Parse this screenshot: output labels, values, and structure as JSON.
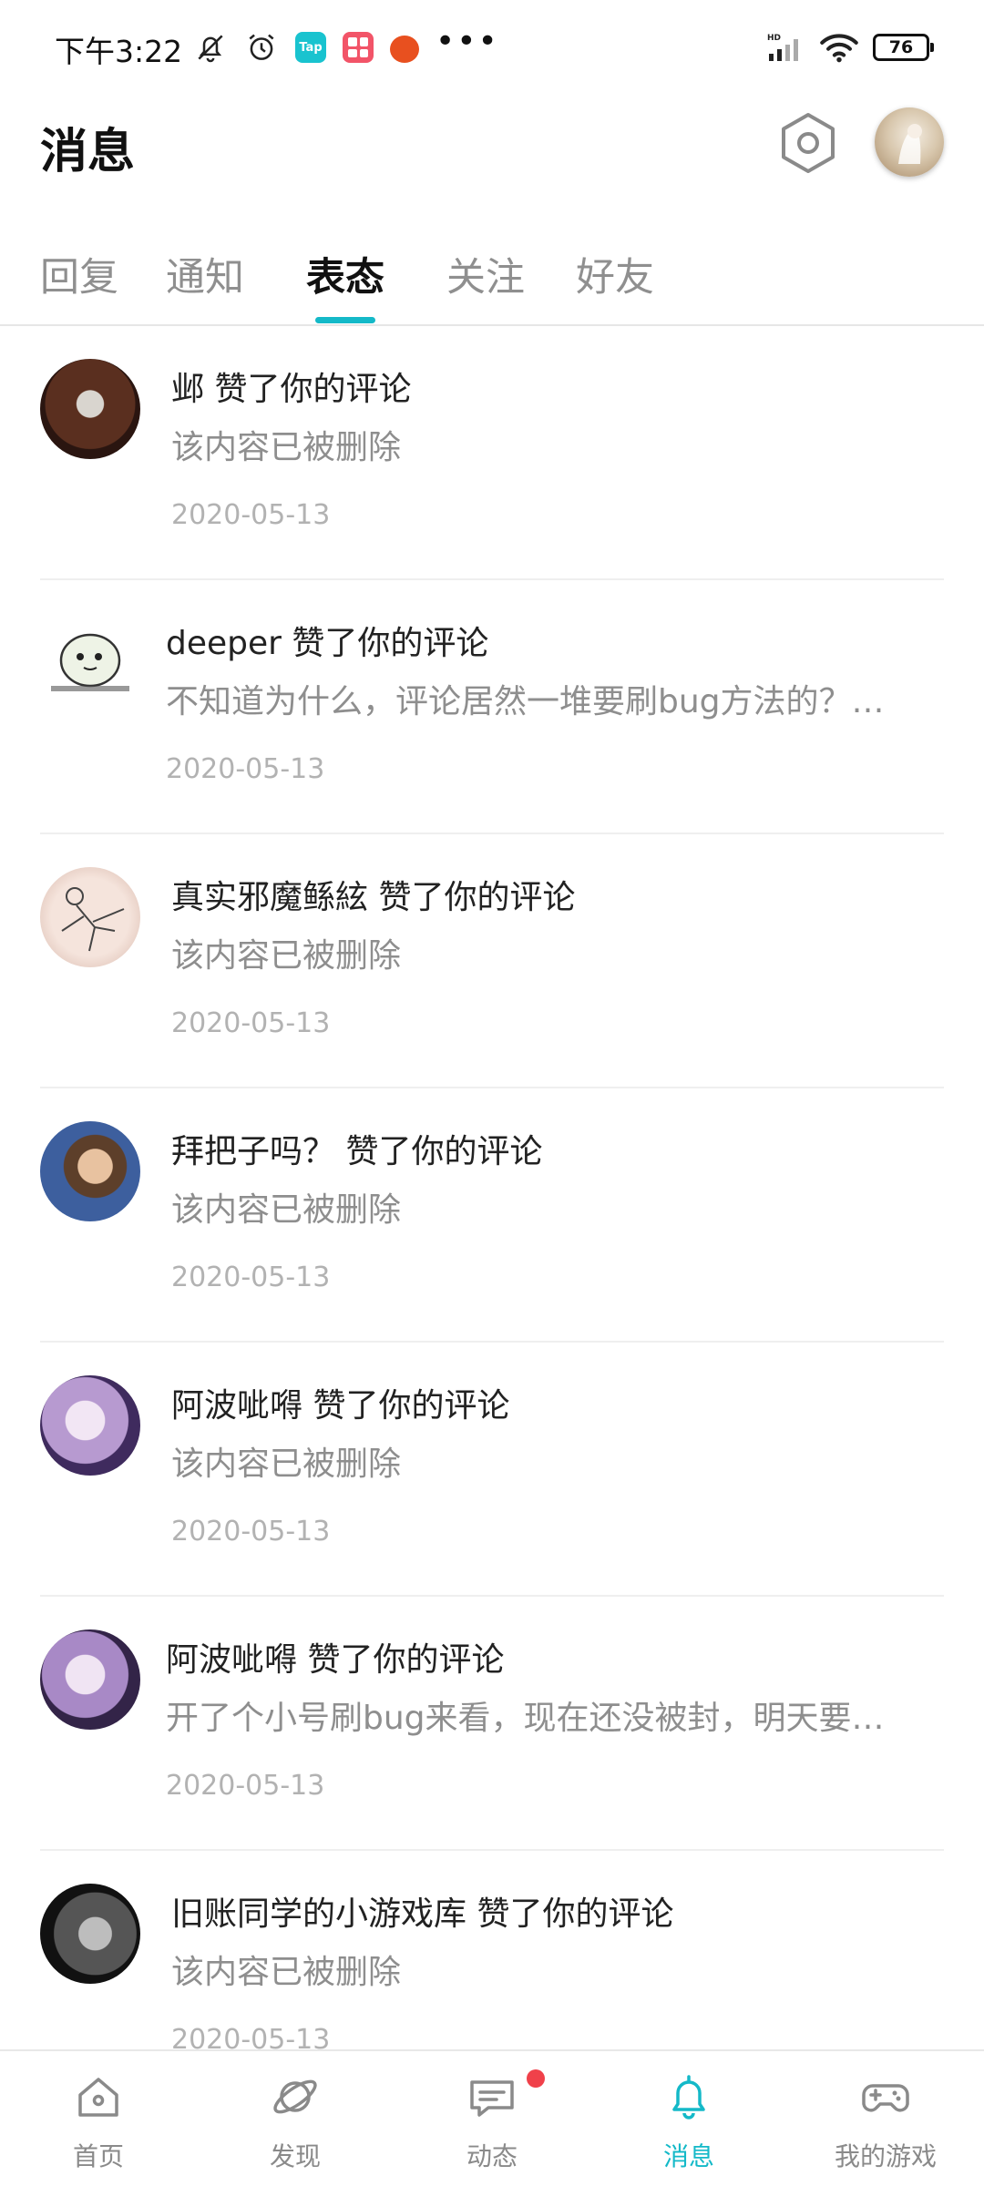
{
  "status_bar": {
    "time": "下午3:22",
    "tap_label": "Tap",
    "battery": "76"
  },
  "header": {
    "title": "消息"
  },
  "tabs": [
    {
      "label": "回复",
      "active": false
    },
    {
      "label": "通知",
      "active": false
    },
    {
      "label": "表态",
      "active": true
    },
    {
      "label": "关注",
      "active": false
    },
    {
      "label": "好友",
      "active": false
    }
  ],
  "messages": [
    {
      "title": "邺 赞了你的评论",
      "body": "该内容已被删除",
      "time": "2020-05-13"
    },
    {
      "title": "deeper 赞了你的评论",
      "body": "不知道为什么，评论居然一堆要刷bug方法的？…",
      "time": "2020-05-13"
    },
    {
      "title": "真实邪魔鲧絃 赞了你的评论",
      "body": "该内容已被删除",
      "time": "2020-05-13"
    },
    {
      "title": "拜把子吗？ 赞了你的评论",
      "body": "该内容已被删除",
      "time": "2020-05-13"
    },
    {
      "title": "阿波呲嘚 赞了你的评论",
      "body": "该内容已被删除",
      "time": "2020-05-13"
    },
    {
      "title": "阿波呲嘚 赞了你的评论",
      "body": "开了个小号刷bug来看，现在还没被封，明天要…",
      "time": "2020-05-13"
    },
    {
      "title": "旧账同学的小游戏库 赞了你的评论",
      "body": "该内容已被删除",
      "time": "2020-05-13"
    }
  ],
  "bottom_nav": [
    {
      "label": "首页",
      "icon": "home-icon",
      "active": false
    },
    {
      "label": "发现",
      "icon": "planet-icon",
      "active": false
    },
    {
      "label": "动态",
      "icon": "chat-icon",
      "active": false,
      "badge": true
    },
    {
      "label": "消息",
      "icon": "bell-icon",
      "active": true
    },
    {
      "label": "我的游戏",
      "icon": "gamepad-icon",
      "active": false
    }
  ],
  "colors": {
    "accent": "#14b9c8",
    "badge": "#f0414a"
  }
}
